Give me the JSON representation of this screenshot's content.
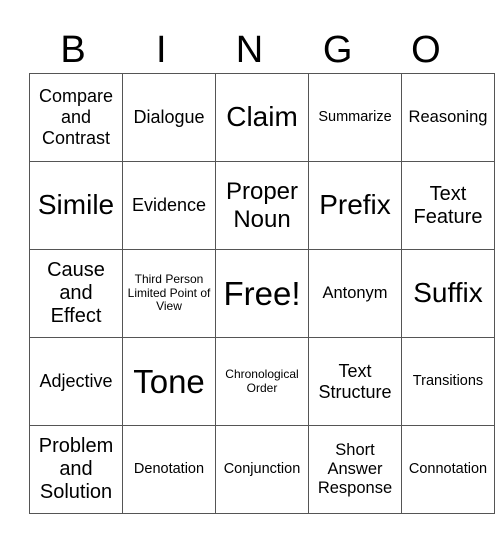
{
  "header": [
    "B",
    "I",
    "N",
    "G",
    "O"
  ],
  "rows": [
    [
      "Compare and Contrast",
      "Dialogue",
      "Claim",
      "Summarize",
      "Reasoning"
    ],
    [
      "Simile",
      "Evidence",
      "Proper Noun",
      "Prefix",
      "Text Feature"
    ],
    [
      "Cause and Effect",
      "Third Person Limited Point of View",
      "Free!",
      "Antonym",
      "Suffix"
    ],
    [
      "Adjective",
      "Tone",
      "Chronological Order",
      "Text Structure",
      "Transitions"
    ],
    [
      "Problem and Solution",
      "Denotation",
      "Conjunction",
      "Short Answer Response",
      "Connotation"
    ]
  ]
}
